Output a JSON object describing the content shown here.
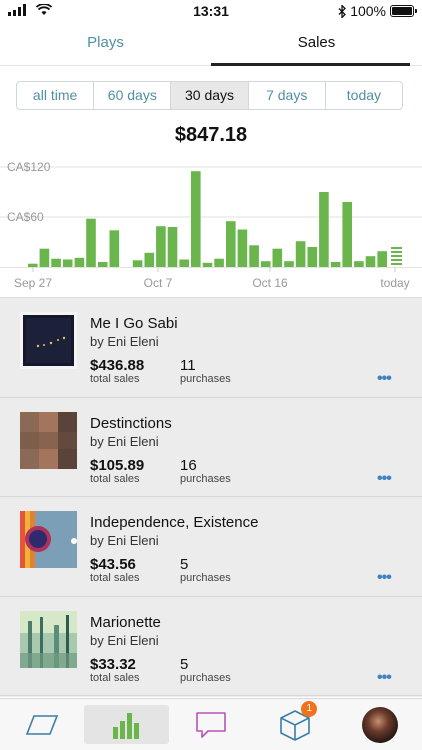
{
  "status": {
    "time": "13:31",
    "battery": "100%"
  },
  "tabs": {
    "plays": "Plays",
    "sales": "Sales"
  },
  "range": {
    "options": [
      "all time",
      "60 days",
      "30 days",
      "7 days",
      "today"
    ],
    "selected": "30 days"
  },
  "total": "$847.18",
  "colors": {
    "bar": "#6ab54c",
    "accent": "#4f8fa3",
    "badge": "#f0721b"
  },
  "chart_data": {
    "type": "bar",
    "currency_ticks": [
      {
        "label": "CA$120",
        "value": 120
      },
      {
        "label": "CA$60",
        "value": 60
      }
    ],
    "ylim": [
      0,
      120
    ],
    "x_labels": [
      "Sep 27",
      "Oct 7",
      "Oct 16",
      "today"
    ],
    "values": [
      4,
      22,
      10,
      9,
      11,
      58,
      6,
      44,
      0,
      8,
      17,
      49,
      48,
      9,
      115,
      5,
      10,
      55,
      45,
      26,
      7,
      22,
      7,
      31,
      24,
      90,
      6,
      78,
      7,
      13,
      19
    ]
  },
  "items": [
    {
      "title": "Me I Go Sabi",
      "artist": "by Eni Eleni",
      "sales": "$436.88",
      "sales_label": "total sales",
      "purchases": "11",
      "purchases_label": "purchases",
      "art": "dark-starfield"
    },
    {
      "title": "Destinctions",
      "artist": "by Eni Eleni",
      "sales": "$105.89",
      "sales_label": "total sales",
      "purchases": "16",
      "purchases_label": "purchases",
      "art": "brown-panels"
    },
    {
      "title": "Independence, Existence",
      "artist": "by Eni Eleni",
      "sales": "$43.56",
      "sales_label": "total sales",
      "purchases": "5",
      "purchases_label": "purchases",
      "art": "colored-stripes"
    },
    {
      "title": "Marionette",
      "artist": "by Eni Eleni",
      "sales": "$33.32",
      "sales_label": "total sales",
      "purchases": "5",
      "purchases_label": "purchases",
      "art": "teal-forest"
    }
  ],
  "more_label": "•••",
  "bottom_nav": {
    "badge_count": "1",
    "icons": [
      "parallelogram-icon",
      "bar-chart-icon",
      "speech-bubble-icon",
      "package-icon",
      "avatar"
    ]
  }
}
